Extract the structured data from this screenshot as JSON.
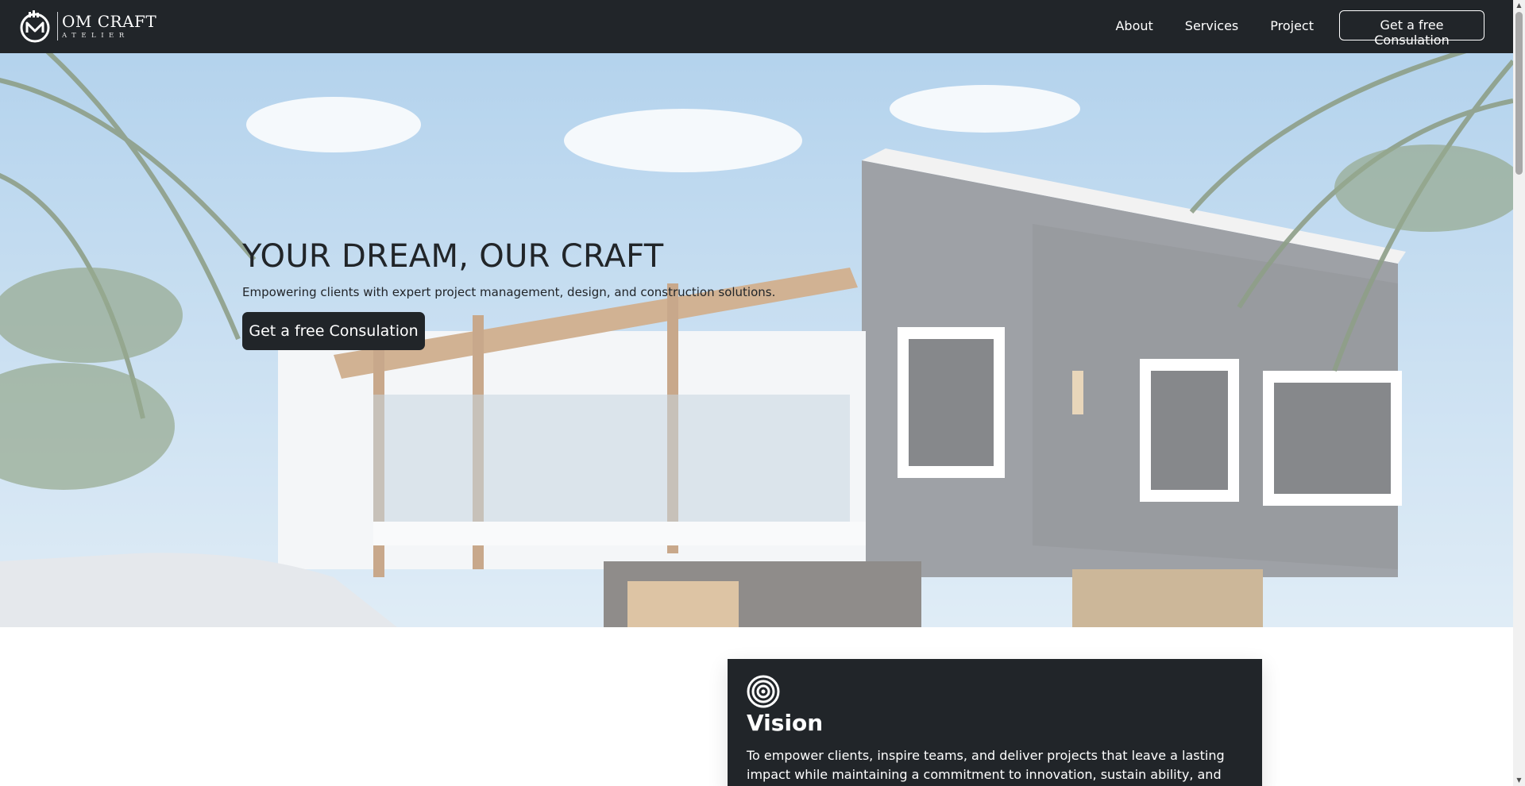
{
  "nav": {
    "brand_name": "OM CRAFT",
    "brand_sub": "ATELIER",
    "links": [
      "About",
      "Services",
      "Project"
    ],
    "cta": "Get a free Consulation"
  },
  "hero": {
    "title": "YOUR DREAM, OUR CRAFT",
    "subtitle": "Empowering clients with expert project management, design, and construction solutions.",
    "cta": "Get a free Consulation"
  },
  "vision": {
    "title": "Vision",
    "text": "To empower clients, inspire teams, and deliver projects that leave a lasting impact while maintaining a commitment to innovation, sustain ability, and exceptional quality.",
    "icon": "target-icon"
  },
  "colors": {
    "dark": "#212529",
    "white": "#ffffff"
  }
}
